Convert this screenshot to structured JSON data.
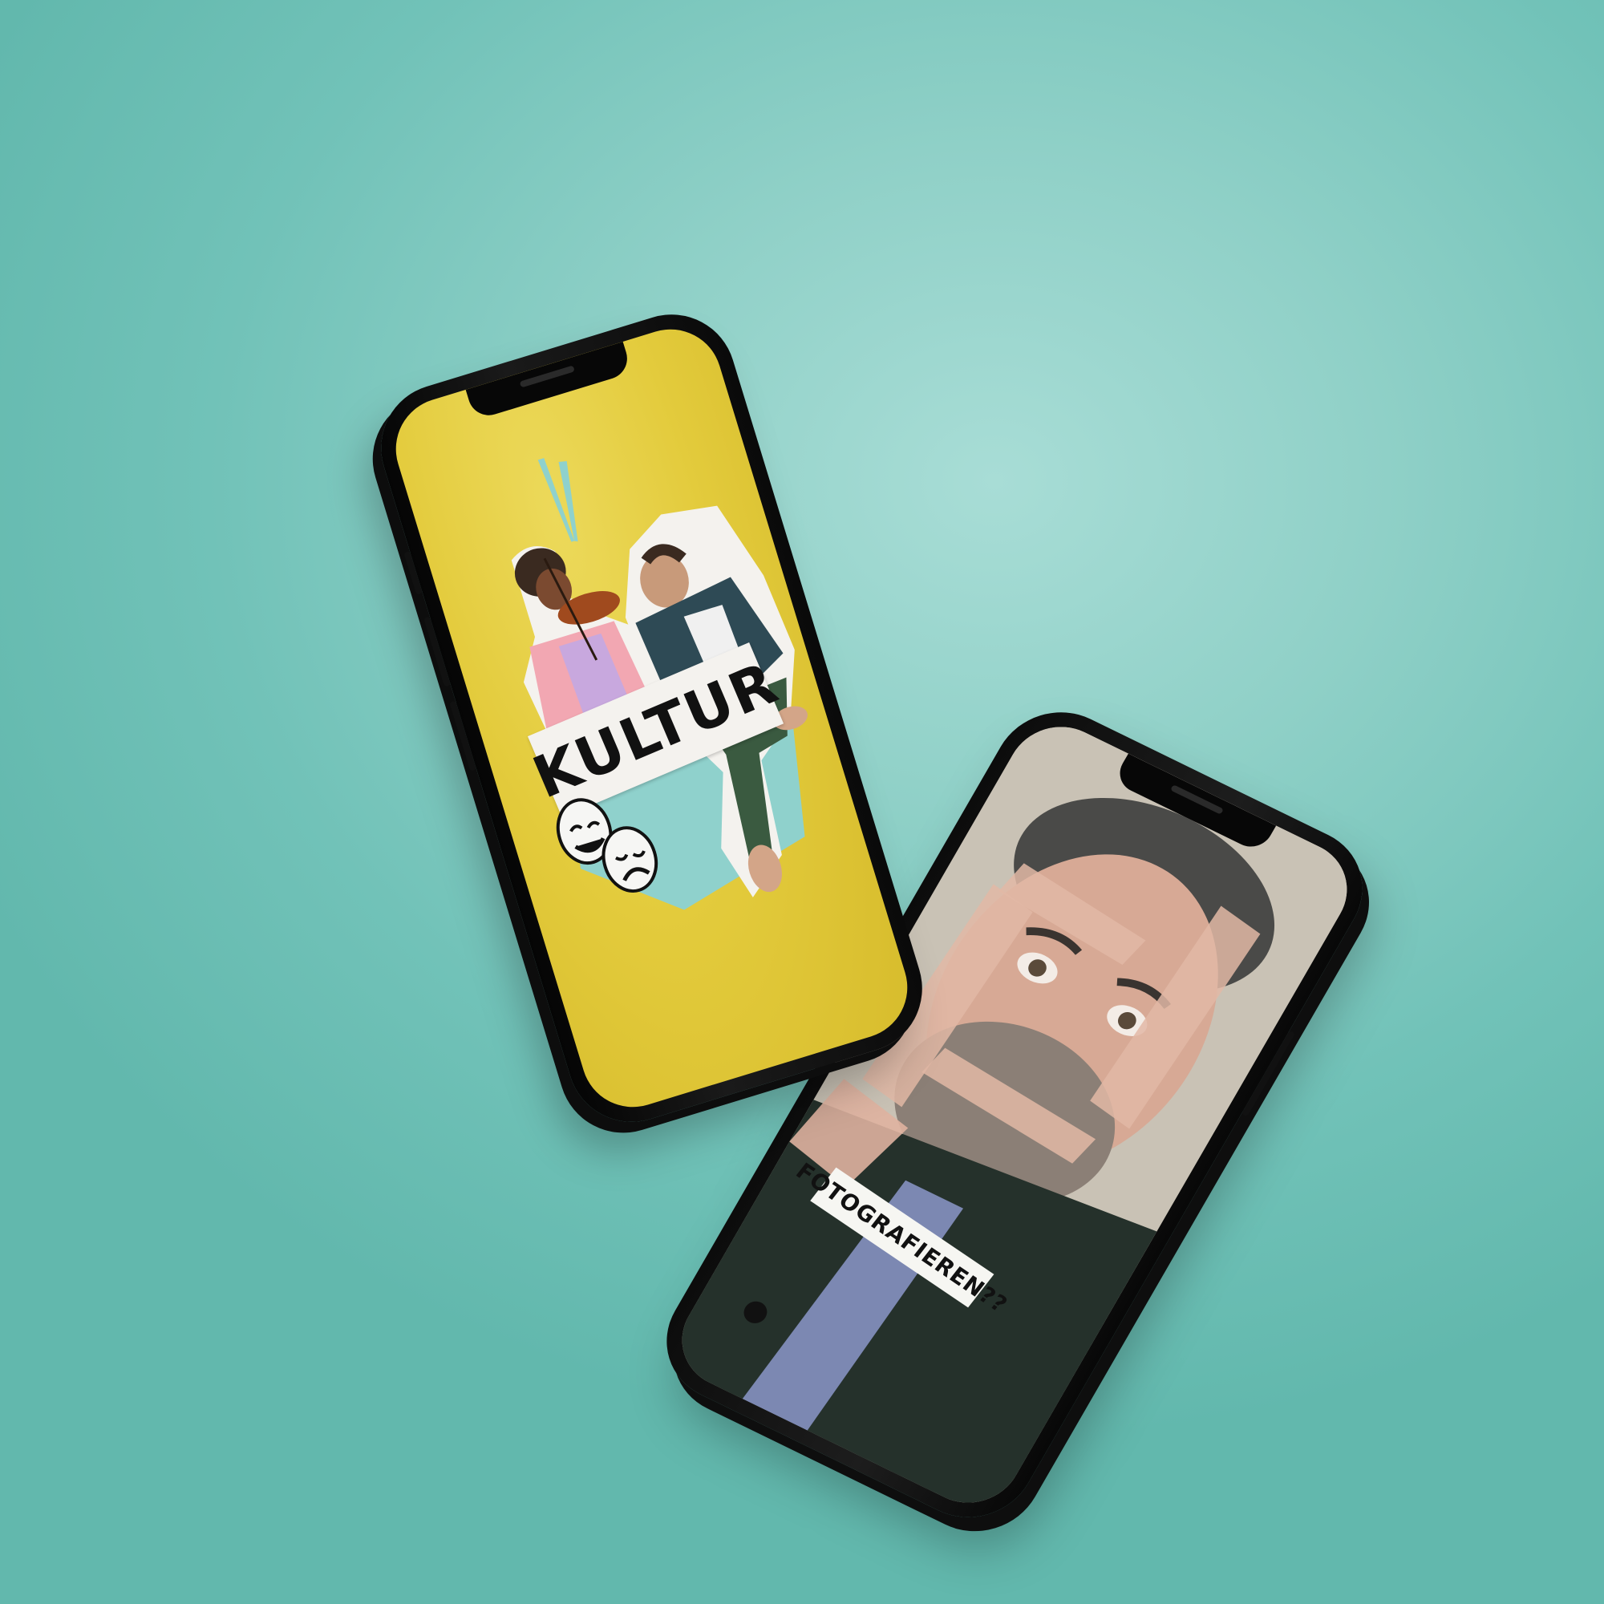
{
  "scene": {
    "background_color": "#8fd0c7",
    "phone_frame_color": "#111111"
  },
  "phone_front": {
    "screen_color": "#e3cb3c",
    "accent_color": "#8fd1cc",
    "title": "KULTUR"
  },
  "phone_back": {
    "caption": "FOTOGRAFIEREN??"
  }
}
